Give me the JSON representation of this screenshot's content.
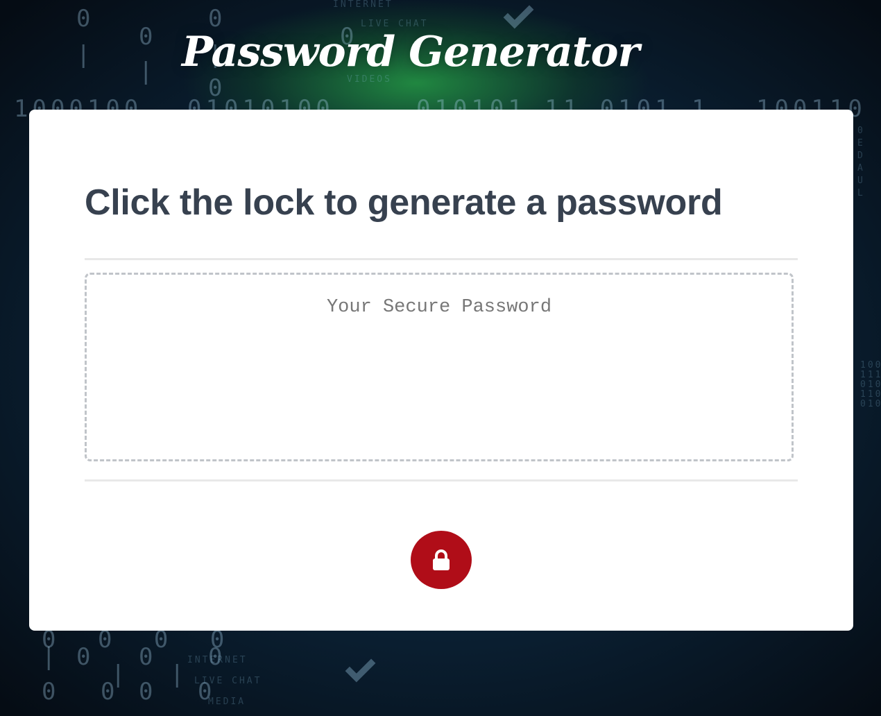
{
  "header": {
    "title": "Password Generator"
  },
  "card": {
    "heading": "Click the lock to generate a password",
    "password_placeholder": "Your Secure Password",
    "password_value": "",
    "generate_button_icon": "lock-icon"
  },
  "colors": {
    "heading_text": "#37414f",
    "button_background": "#b00d18",
    "card_background": "#ffffff"
  }
}
